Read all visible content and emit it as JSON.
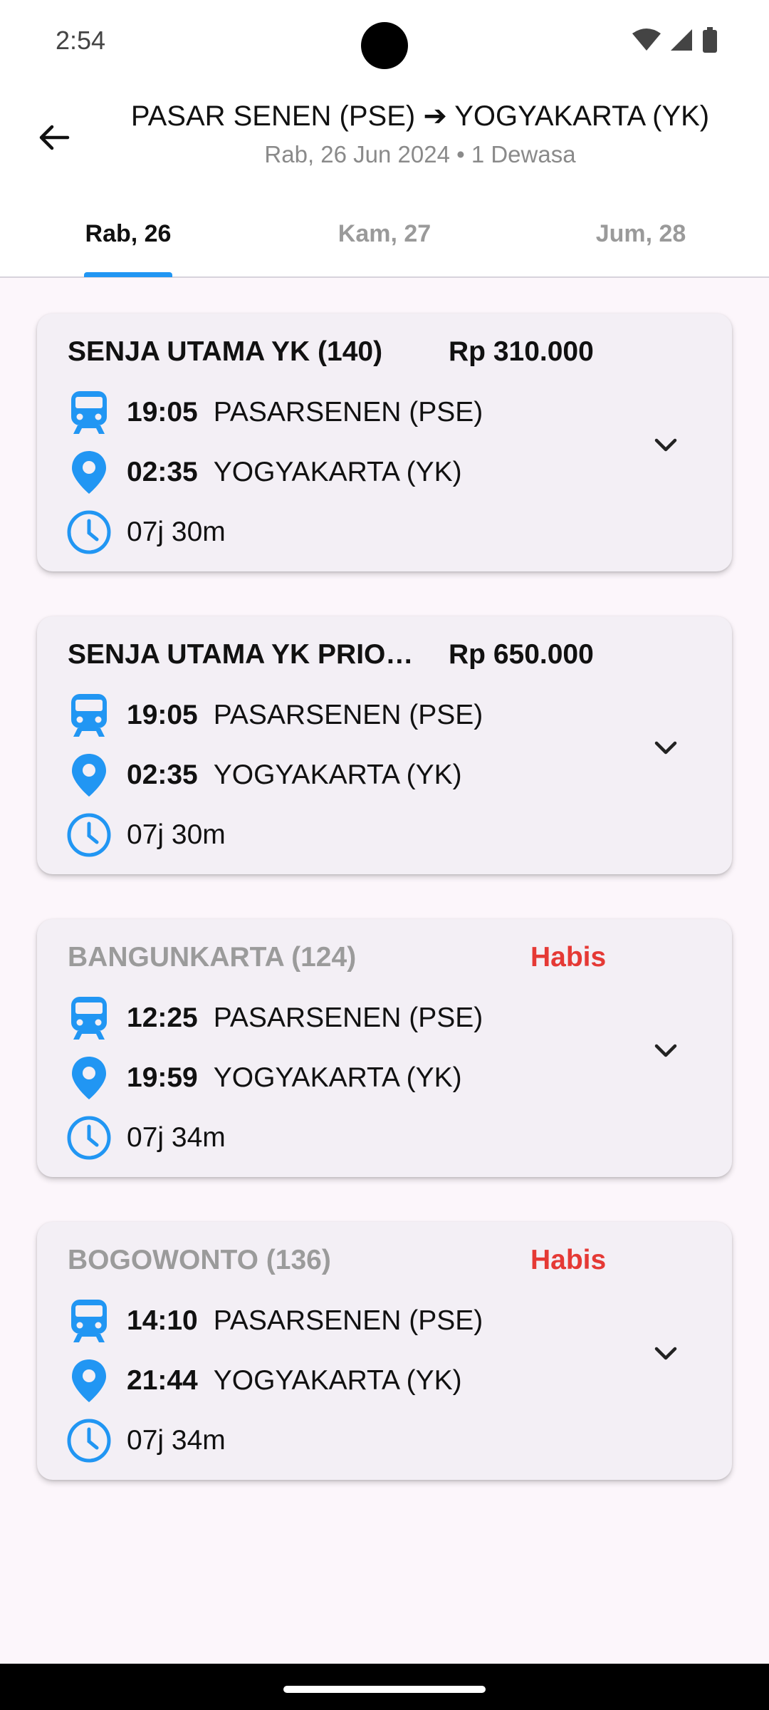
{
  "status": {
    "time": "2:54"
  },
  "header": {
    "title": "PASAR SENEN (PSE) ➔ YOGYAKARTA (YK)",
    "subtitle": "Rab, 26 Jun 2024 • 1 Dewasa"
  },
  "tabs": [
    {
      "label": "Rab, 26",
      "active": true
    },
    {
      "label": "Kam, 27",
      "active": false
    },
    {
      "label": "Jum, 28",
      "active": false
    }
  ],
  "colors": {
    "accent": "#2196f3",
    "soldout": "#e53935"
  },
  "icons": [
    "back-arrow-icon",
    "train-icon",
    "location-pin-icon",
    "clock-icon",
    "chevron-down-icon"
  ],
  "trains": [
    {
      "name": "SENJA UTAMA YK (140)",
      "price": "Rp 310.000",
      "depart_time": "19:05",
      "depart_station": "PASARSENEN (PSE)",
      "arrive_time": "02:35",
      "arrive_station": "YOGYAKARTA (YK)",
      "duration": "07j 30m",
      "sold_out": false
    },
    {
      "name": "SENJA UTAMA YK PRIORITAS",
      "price": "Rp 650.000",
      "depart_time": "19:05",
      "depart_station": "PASARSENEN (PSE)",
      "arrive_time": "02:35",
      "arrive_station": "YOGYAKARTA (YK)",
      "duration": "07j 30m",
      "sold_out": false
    },
    {
      "name": "BANGUNKARTA (124)",
      "price": "Habis",
      "depart_time": "12:25",
      "depart_station": "PASARSENEN (PSE)",
      "arrive_time": "19:59",
      "arrive_station": "YOGYAKARTA (YK)",
      "duration": "07j 34m",
      "sold_out": true
    },
    {
      "name": "BOGOWONTO (136)",
      "price": "Habis",
      "depart_time": "14:10",
      "depart_station": "PASARSENEN (PSE)",
      "arrive_time": "21:44",
      "arrive_station": "YOGYAKARTA (YK)",
      "duration": "07j 34m",
      "sold_out": true
    }
  ]
}
